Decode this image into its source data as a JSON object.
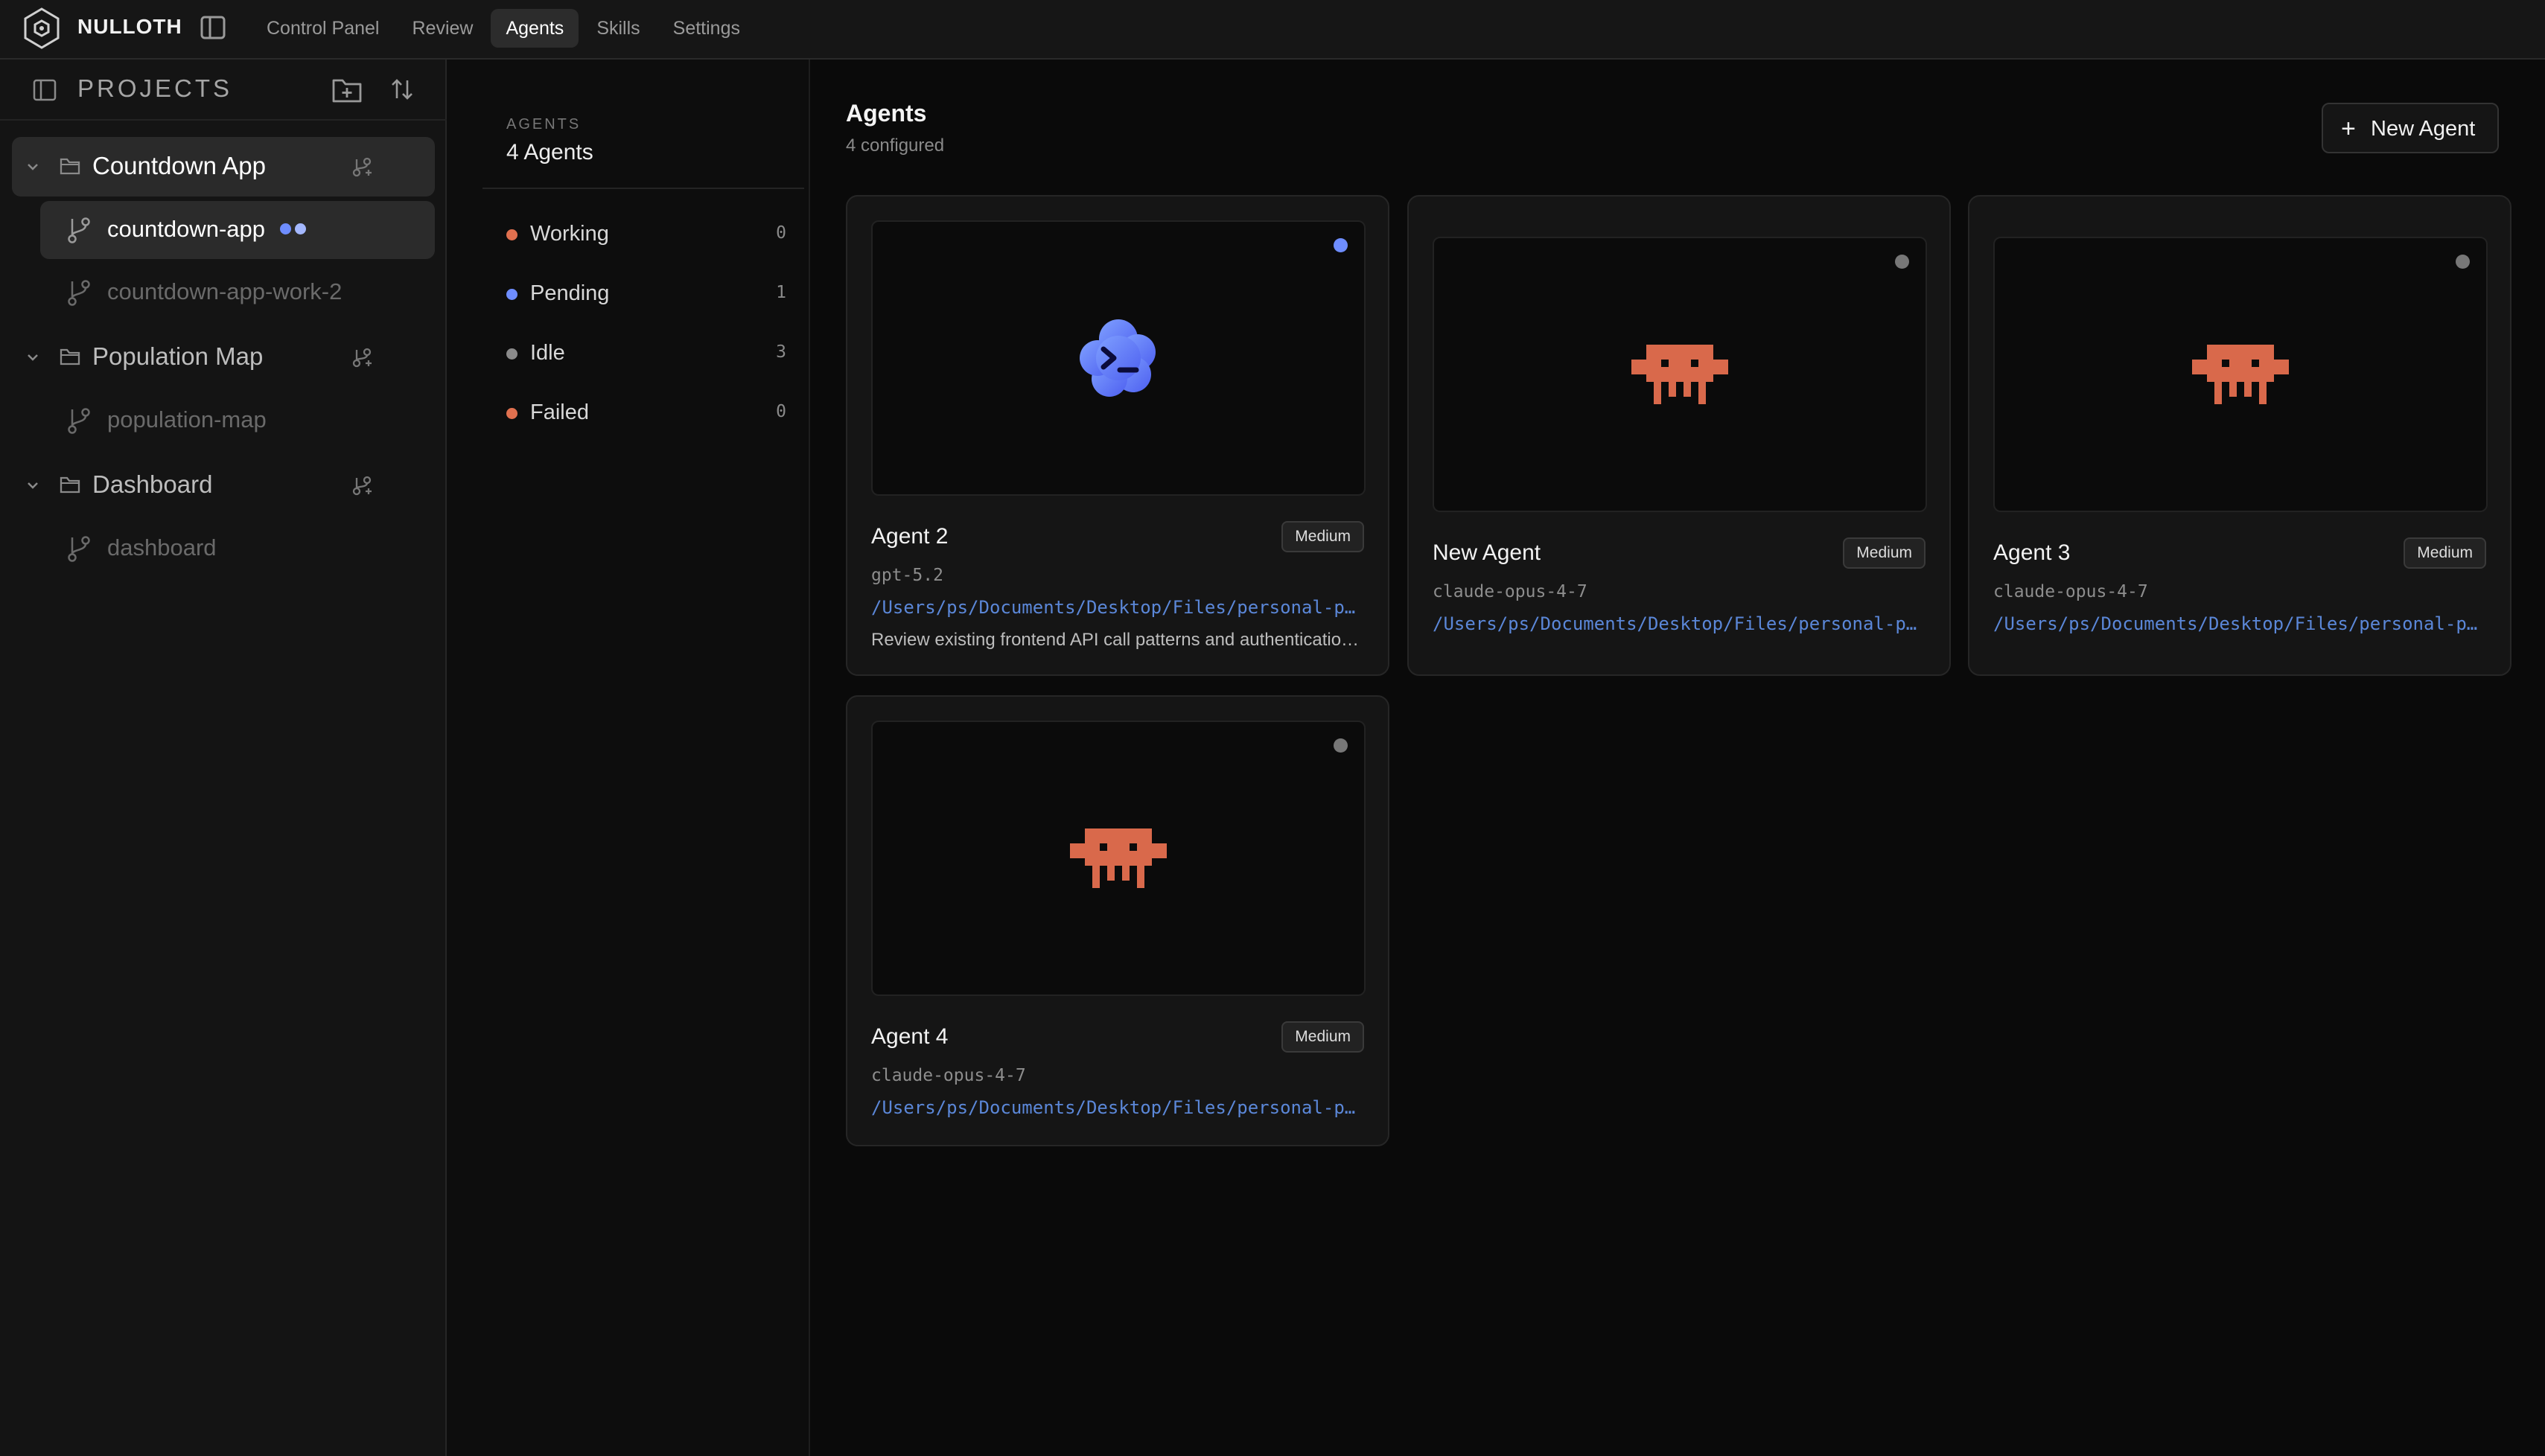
{
  "app": {
    "brand": "NULLOTH"
  },
  "nav": {
    "items": [
      "Control Panel",
      "Review",
      "Agents",
      "Skills",
      "Settings"
    ],
    "active": "Agents"
  },
  "sidebar": {
    "title": "PROJECTS",
    "projects": [
      {
        "name": "Countdown App",
        "expanded": true,
        "active": true,
        "branches": [
          {
            "name": "countdown-app",
            "active": true
          },
          {
            "name": "countdown-app-work-2",
            "active": false
          }
        ]
      },
      {
        "name": "Population Map",
        "expanded": true,
        "active": false,
        "branches": [
          {
            "name": "population-map",
            "active": false
          }
        ]
      },
      {
        "name": "Dashboard",
        "expanded": true,
        "active": false,
        "branches": [
          {
            "name": "dashboard",
            "active": false
          }
        ]
      }
    ]
  },
  "status": {
    "label": "AGENTS",
    "count_text": "4 Agents",
    "rows": [
      {
        "label": "Working",
        "count": "0",
        "color": "#e0704f"
      },
      {
        "label": "Pending",
        "count": "1",
        "color": "#6e8dff"
      },
      {
        "label": "Idle",
        "count": "3",
        "color": "#8a8a8a"
      },
      {
        "label": "Failed",
        "count": "0",
        "color": "#e0704f"
      }
    ]
  },
  "main": {
    "title": "Agents",
    "subtitle": "4 configured",
    "new_button": "New Agent"
  },
  "agents": [
    {
      "name": "Agent 2",
      "badge": "Medium",
      "model": "gpt-5.2",
      "path": "/Users/ps/Documents/Desktop/Files/personal-projects/countdown-app",
      "description": "Review existing frontend API call patterns and authentication flow",
      "status_color": "#6e8dff",
      "avatar": "terminal-cloud-icon"
    },
    {
      "name": "New Agent",
      "badge": "Medium",
      "model": "claude-opus-4-7",
      "path": "/Users/ps/Documents/Desktop/Files/personal-projects/countdown-app",
      "description": "",
      "status_color": "#777777",
      "avatar": "pixel-crab-icon"
    },
    {
      "name": "Agent 3",
      "badge": "Medium",
      "model": "claude-opus-4-7",
      "path": "/Users/ps/Documents/Desktop/Files/personal-projects/countdown-app",
      "description": "",
      "status_color": "#777777",
      "avatar": "pixel-crab-icon"
    },
    {
      "name": "Agent 4",
      "badge": "Medium",
      "model": "claude-opus-4-7",
      "path": "/Users/ps/Documents/Desktop/Files/personal-projects/countdown-app",
      "description": "",
      "status_color": "#777777",
      "avatar": "pixel-crab-icon"
    }
  ],
  "colors": {
    "accent_blue": "#6e8dff",
    "crab_orange": "#d9694b",
    "path_blue": "#5b87d8"
  }
}
